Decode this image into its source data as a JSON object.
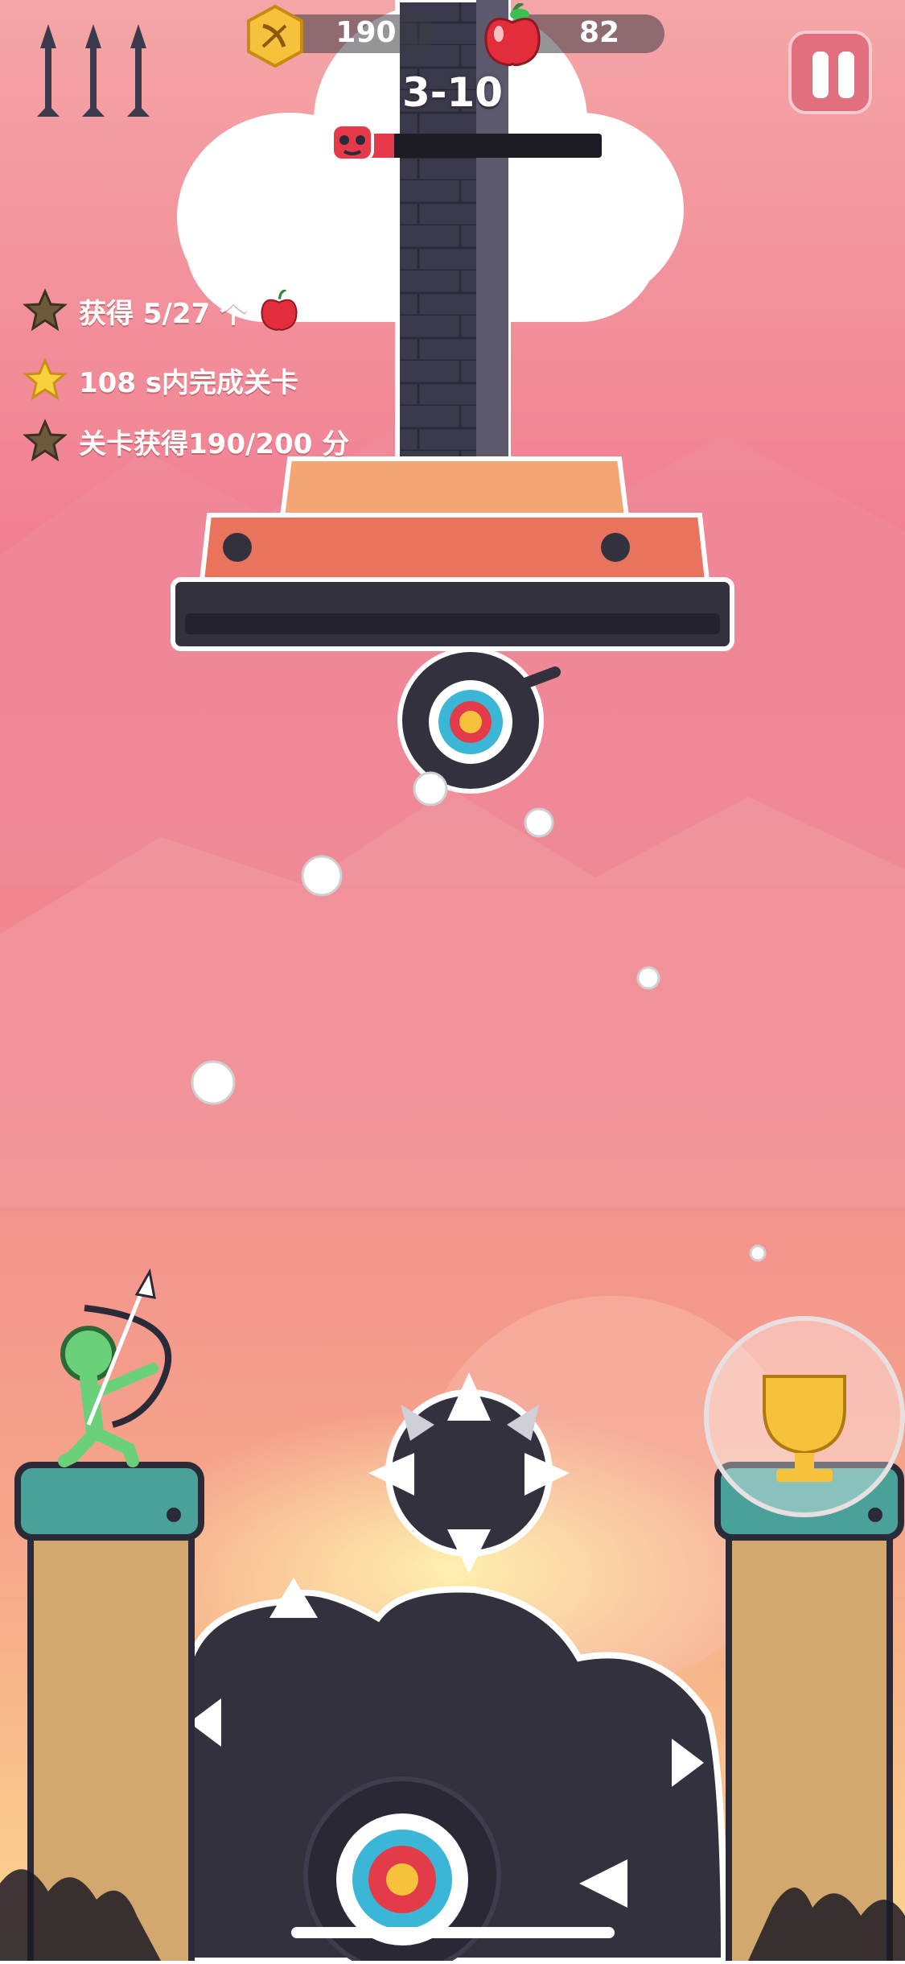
{
  "hud": {
    "arrows_icon": "arrow-icon",
    "coins": "190",
    "apples": "82",
    "level": "3-10",
    "boss_health_percent": 14
  },
  "objectives": [
    {
      "icon": "star-dim-icon",
      "text": "获得 5/27 个",
      "has_apple": true
    },
    {
      "icon": "star-gold-icon",
      "text": "108 s内完成关卡",
      "has_apple": false
    },
    {
      "icon": "star-dim-icon",
      "text": "关卡获得190/200 分",
      "has_apple": false
    }
  ],
  "colors": {
    "sky_top": "#f4a3a8",
    "sky_mid": "#f07c8e",
    "sky_bottom": "#fcd38a",
    "boss_dark": "#34313f",
    "accent_red": "#e63a4a",
    "pillar_top": "#4aa19a",
    "pillar_body": "#d3a86e",
    "archer": "#6bd07a"
  }
}
